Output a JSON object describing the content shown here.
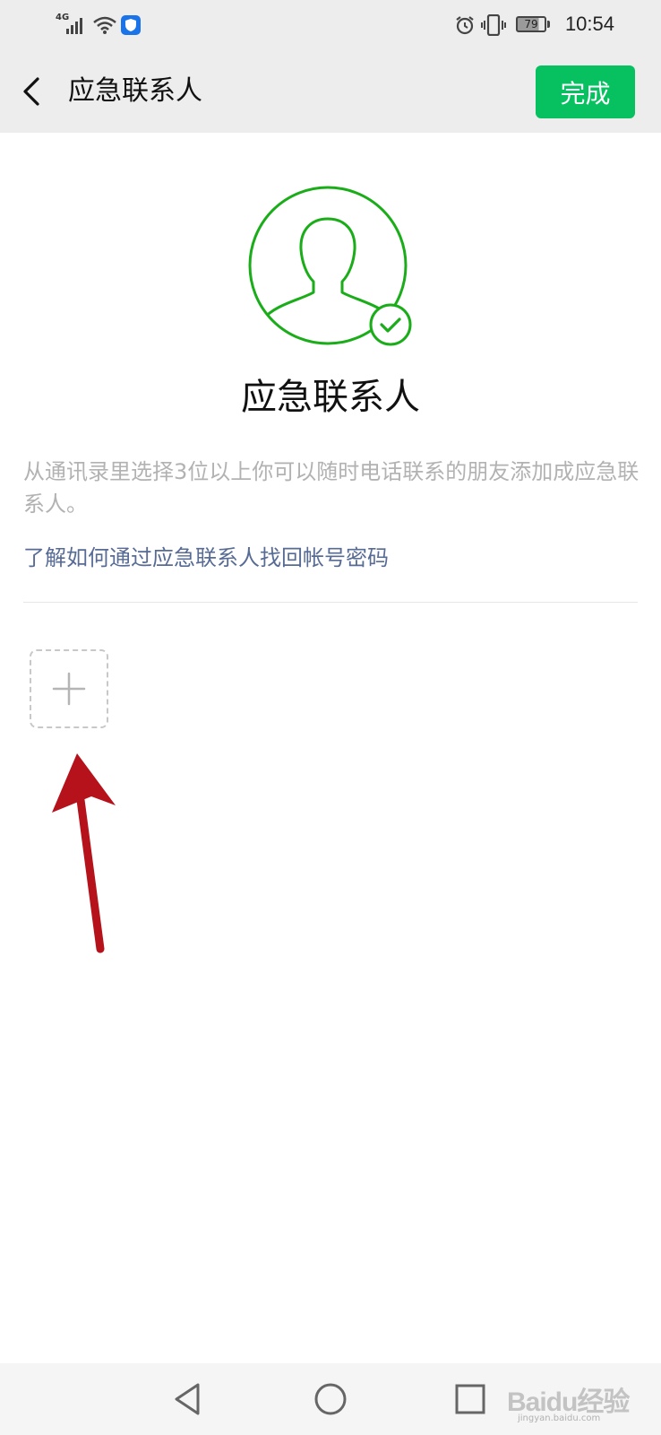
{
  "status_bar": {
    "network": "4G",
    "time": "10:54",
    "battery": "79",
    "icons": [
      "signal-icon",
      "wifi-icon",
      "shield-icon",
      "alarm-icon",
      "vibrate-icon",
      "battery-icon"
    ]
  },
  "nav": {
    "title": "应急联系人",
    "done_label": "完成"
  },
  "hero": {
    "title": "应急联系人"
  },
  "description": "从通讯录里选择3位以上你可以随时电话联系的朋友添加成应急联系人。",
  "learn_link": "了解如何通过应急联系人找回帐号密码",
  "watermark": {
    "brand": "Baidu经验",
    "url": "jingyan.baidu.com"
  },
  "colors": {
    "accent": "#07c160",
    "link": "#576b95",
    "muted": "#b2b2b2",
    "annotation_arrow": "#b5121b"
  }
}
